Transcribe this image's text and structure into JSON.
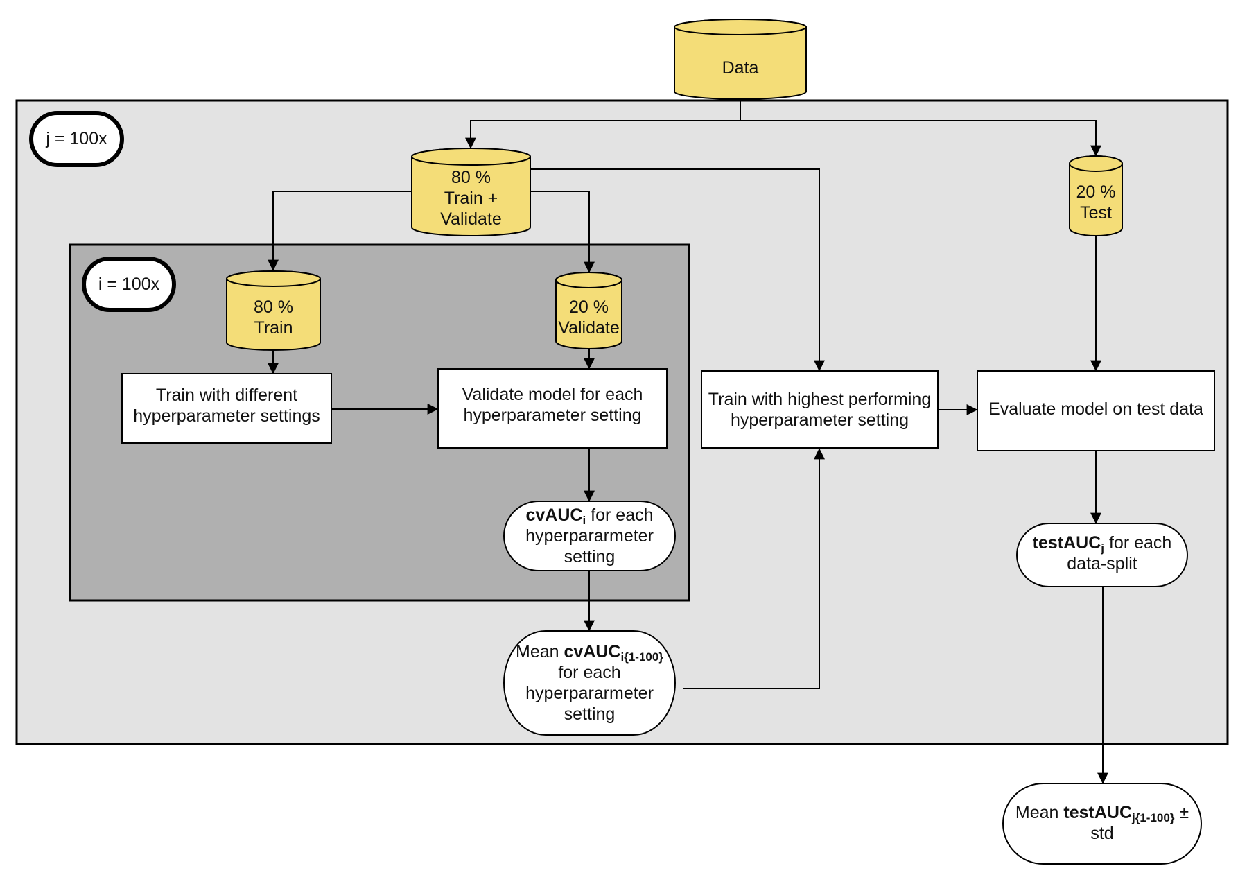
{
  "colors": {
    "cylinder_fill": "#f4dd78",
    "outer_loop_bg": "#e3e3e3",
    "inner_loop_bg": "#b0b0b0",
    "box_fill": "#ffffff",
    "stroke": "#000000"
  },
  "outer_loop": {
    "label": "j = 100x"
  },
  "inner_loop": {
    "label": "i = 100x"
  },
  "datastores": {
    "data": {
      "lines": [
        "Data"
      ]
    },
    "train_validate": {
      "lines": [
        "80 %",
        "Train +",
        "Validate"
      ]
    },
    "test": {
      "lines": [
        "20 %",
        "Test"
      ]
    },
    "train": {
      "lines": [
        "80 %",
        "Train"
      ]
    },
    "validate": {
      "lines": [
        "20 %",
        "Validate"
      ]
    }
  },
  "processes": {
    "train_different": {
      "lines": [
        "Train with different",
        "hyperparameter settings"
      ]
    },
    "validate_each": {
      "lines": [
        "Validate model for each",
        "hyperparameter setting"
      ]
    },
    "train_highest": {
      "lines": [
        "Train with highest performing",
        "hyperparameter setting"
      ]
    },
    "evaluate_test": {
      "lines": [
        "Evaluate model on test data"
      ]
    }
  },
  "results": {
    "cv_auc": {
      "bold": "cvAUC",
      "sub": "i",
      "rest": " for each",
      "lines": [
        "hyperpararmeter",
        "setting"
      ]
    },
    "mean_cv_auc": {
      "prefix": "Mean ",
      "bold": "cvAUC",
      "sub": "i{1-100}",
      "lines": [
        "for each",
        "hyperpararmeter",
        "setting"
      ]
    },
    "test_auc": {
      "bold": "testAUC",
      "sub": "j",
      "rest": " for each",
      "lines": [
        "data-split"
      ]
    },
    "mean_test_auc": {
      "prefix": "Mean ",
      "bold": "testAUC",
      "sub": "j{1-100}",
      "rest": " ±",
      "lines": [
        "std"
      ]
    }
  }
}
